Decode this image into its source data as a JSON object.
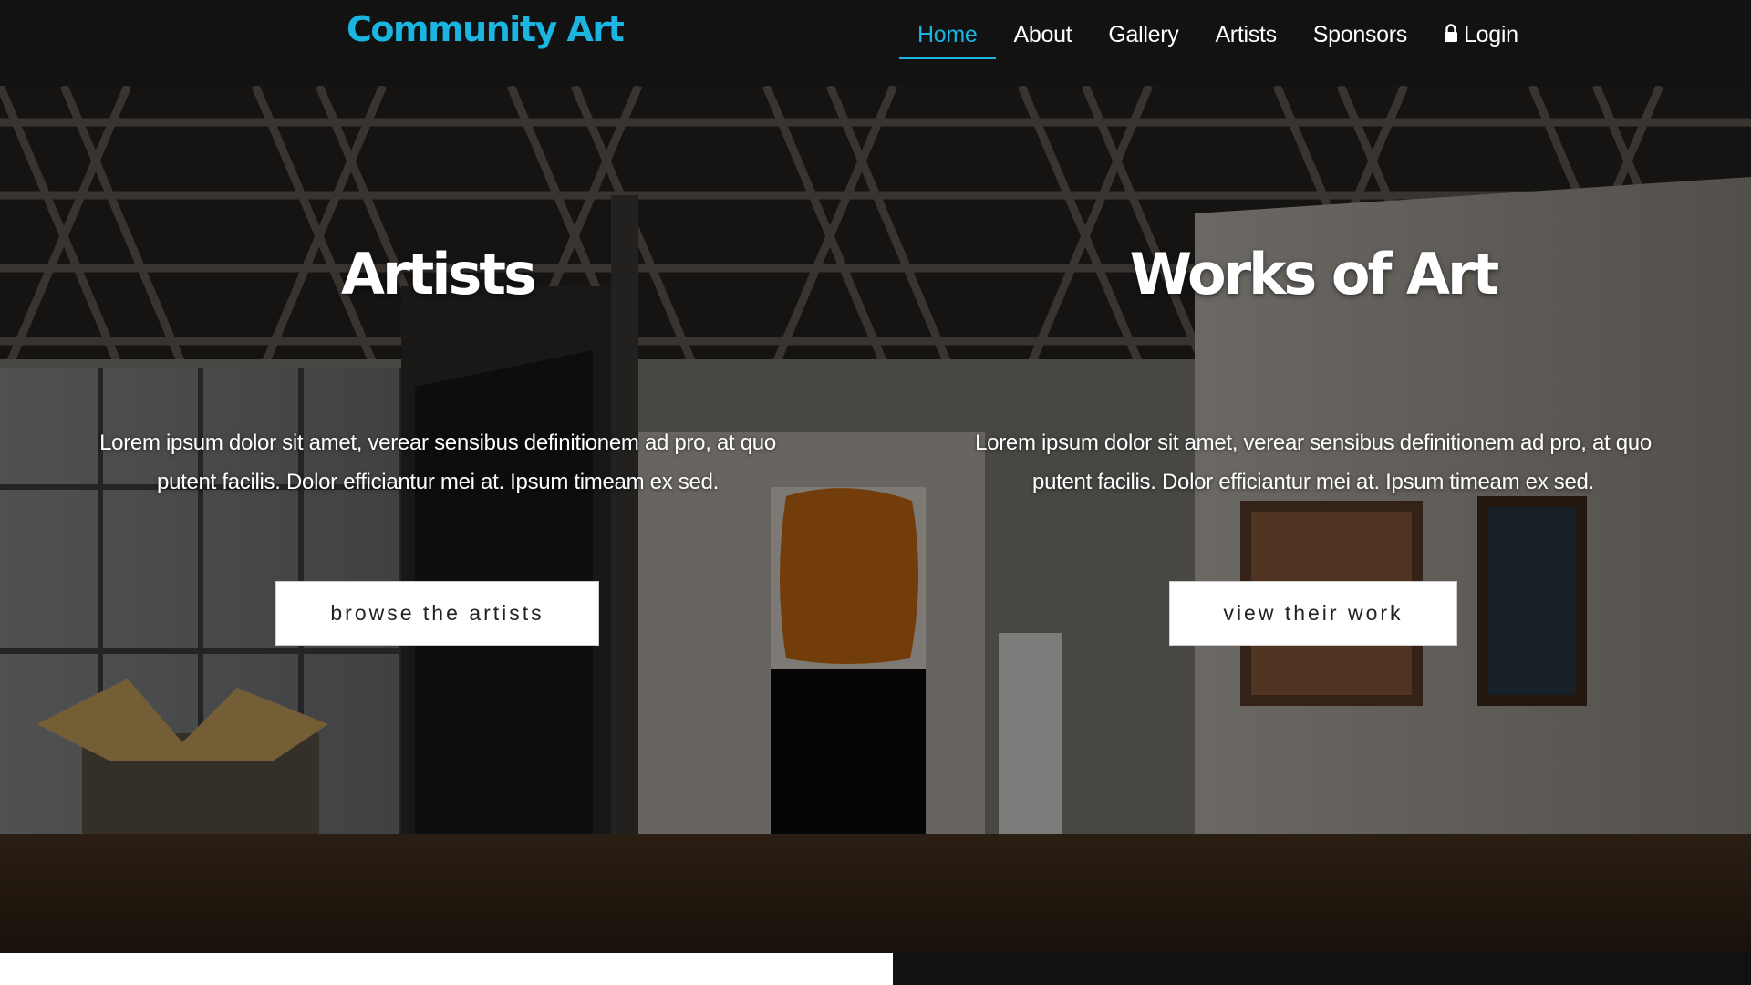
{
  "brand": {
    "name": "Community Art"
  },
  "nav": {
    "items": [
      {
        "label": "Home",
        "active": true
      },
      {
        "label": "About",
        "active": false
      },
      {
        "label": "Gallery",
        "active": false
      },
      {
        "label": "Artists",
        "active": false
      },
      {
        "label": "Sponsors",
        "active": false
      },
      {
        "label": "Login",
        "icon": "lock-icon",
        "active": false
      }
    ]
  },
  "hero": {
    "left": {
      "title": "Artists",
      "text": "Lorem ipsum dolor sit amet, verear sensibus definitionem ad pro, at quo putent facilis. Dolor efficiantur mei at. Ipsum timeam ex sed.",
      "button": "browse the artists"
    },
    "right": {
      "title": "Works of Art",
      "text": "Lorem ipsum dolor sit amet, verear sensibus definitionem ad pro, at quo putent facilis. Dolor efficiantur mei at. Ipsum timeam ex sed.",
      "button": "view their work"
    }
  },
  "colors": {
    "accent": "#1ab5e0",
    "navbar": "#121212",
    "button_bg": "#ffffff"
  }
}
